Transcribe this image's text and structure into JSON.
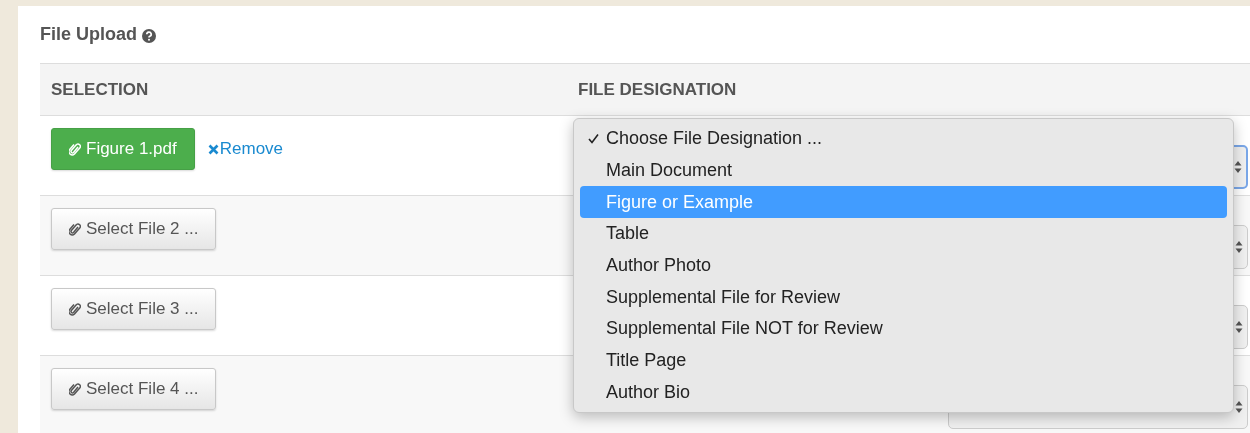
{
  "section": {
    "title": "File Upload"
  },
  "table": {
    "columns": [
      "SELECTION",
      "FILE DESIGNATION"
    ],
    "rows": [
      {
        "file": "Figure 1.pdf",
        "uploaded": true,
        "remove": "Remove",
        "focused": true
      },
      {
        "file": "Select File 2 ...",
        "uploaded": false,
        "focused": false
      },
      {
        "file": "Select File 3 ...",
        "uploaded": false,
        "focused": false
      },
      {
        "file": "Select File 4 ...",
        "uploaded": false,
        "focused": false
      }
    ]
  },
  "menu": {
    "options": [
      {
        "label": "Choose File Designation ...",
        "checked": true,
        "selected": false
      },
      {
        "label": "Main Document",
        "checked": false,
        "selected": false
      },
      {
        "label": "Figure or Example",
        "checked": false,
        "selected": true
      },
      {
        "label": "Table",
        "checked": false,
        "selected": false
      },
      {
        "label": "Author Photo",
        "checked": false,
        "selected": false
      },
      {
        "label": "Supplemental File for Review",
        "checked": false,
        "selected": false
      },
      {
        "label": "Supplemental File NOT for Review",
        "checked": false,
        "selected": false
      },
      {
        "label": "Title Page",
        "checked": false,
        "selected": false
      },
      {
        "label": "Author Bio",
        "checked": false,
        "selected": false
      }
    ]
  }
}
